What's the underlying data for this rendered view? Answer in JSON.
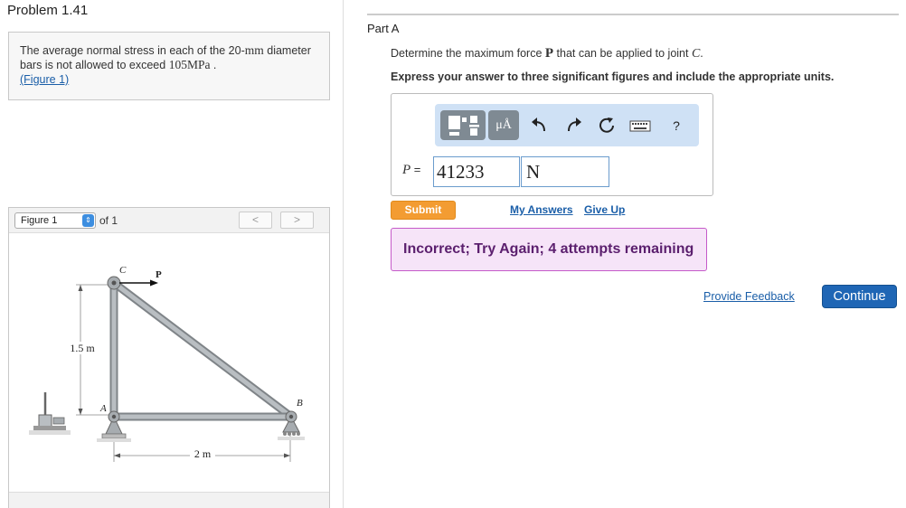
{
  "problem": {
    "title": "Problem 1.41",
    "text_part1": "The average normal stress in each of the 20-",
    "text_unit_mm": "mm",
    "text_part2": " diameter bars is not allowed to exceed ",
    "text_stress": "105MPa",
    "text_part3": " .",
    "figure_link": "(Figure 1)"
  },
  "figure_panel": {
    "select_value": "Figure 1",
    "of_text": "of 1",
    "prev_label": "<",
    "next_label": ">",
    "diagram": {
      "label_C": "C",
      "label_P": "P",
      "label_A": "A",
      "label_B": "B",
      "height_dim": "1.5 m",
      "width_dim": "2 m"
    }
  },
  "part": {
    "title": "Part A",
    "question_part1": "Determine the maximum force ",
    "question_bold": "P",
    "question_part2": " that can be applied to joint ",
    "question_joint": "C",
    "question_part3": ".",
    "instructions": "Express your answer to three significant figures and include the appropriate units.",
    "toolbar": {
      "mu_label": "μÅ",
      "undo_icon": "undo-icon",
      "redo_icon": "redo-icon",
      "reset_icon": "reset-icon",
      "keyboard_icon": "keyboard-icon",
      "help_label": "?"
    },
    "answer_label": "P",
    "answer_eq": " = ",
    "answer_value": "41233",
    "unit_value": "N",
    "submit_label": "Submit",
    "my_answers_label": "My Answers",
    "give_up_label": "Give Up",
    "feedback_text": "Incorrect; Try Again; 4 attempts remaining"
  },
  "footer": {
    "provide_feedback_label": "Provide Feedback",
    "continue_label": "Continue"
  },
  "colors": {
    "submit": "#f39c32",
    "continue": "#1f66b5",
    "link": "#1a5ea8",
    "feedback_bg": "#f6e4f8",
    "feedback_border": "#c55ac9",
    "toolbar_bg": "#cfe1f5"
  }
}
